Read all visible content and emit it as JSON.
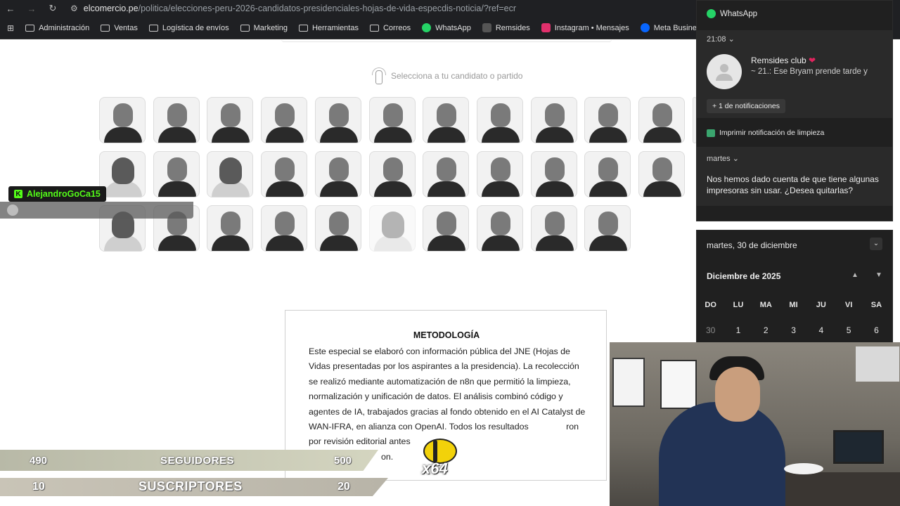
{
  "browser": {
    "nav": {
      "back": "←",
      "forward": "→",
      "reload": "↻"
    },
    "url": {
      "host": "elcomercio.pe",
      "path": "/politica/elecciones-peru-2026-candidatos-presidenciales-hojas-de-vida-especdis-noticia/?ref=ecr"
    },
    "bookmarks": [
      {
        "label": "Administración",
        "icon": "folder-icon"
      },
      {
        "label": "Ventas",
        "icon": "folder-icon"
      },
      {
        "label": "Logística de envíos",
        "icon": "folder-icon"
      },
      {
        "label": "Marketing",
        "icon": "folder-icon"
      },
      {
        "label": "Herramientas",
        "icon": "folder-icon"
      },
      {
        "label": "Correos",
        "icon": "folder-icon"
      },
      {
        "label": "WhatsApp",
        "icon": "whatsapp-icon",
        "color": "#25d366"
      },
      {
        "label": "Remsides",
        "icon": "remsides-icon",
        "color": "#555555"
      },
      {
        "label": "Instagram • Mensajes",
        "icon": "instagram-icon",
        "color": "#e1306c"
      },
      {
        "label": "Meta Business Suite",
        "icon": "meta-icon",
        "color": "#0866ff"
      }
    ]
  },
  "page": {
    "selector_hint": "Selecciona a tu candidato o partido",
    "methodology": {
      "title": "METODOLOGÍA",
      "body": "Este especial se elaboró con información pública del JNE (Hojas de Vidas presentadas por los aspirantes a la presidencia). La recolección se realizó mediante automatización de n8n que permitió la limpieza, normalización y unificación de datos. El análisis combinó código y agentes de IA, trabajados gracias al fondo obtenido en el AI Catalyst de WAN-IFRA, en alianza con OpenAI. Todos los resultados",
      "tail_1": "ron por revisión editorial antes",
      "tail_2": "on."
    }
  },
  "stream": {
    "chat_user": "AlejandroGoCa15",
    "followers": {
      "current": "490",
      "label": "SEGUIDORES",
      "goal": "500"
    },
    "subscribers": {
      "current": "10",
      "label": "SUSCRIPTORES",
      "goal": "20"
    },
    "multiplier": "x64"
  },
  "notifications": {
    "app": "WhatsApp",
    "time": "21:08",
    "chat_title": "Remsides club",
    "chat_message": "~ 21.: Ese Bryam prende tarde y",
    "more": "+ 1 de notificaciones",
    "printer_title": "Imprimir notificación de limpieza",
    "printer_day": "martes",
    "printer_message": "Nos hemos dado cuenta de que tiene algunas impresoras sin usar. ¿Desea quitarlas?"
  },
  "calendar": {
    "date": "martes, 30 de diciembre",
    "month": "Diciembre de 2025",
    "dows": [
      "DO",
      "LU",
      "MA",
      "MI",
      "JU",
      "VI",
      "SA"
    ],
    "days": [
      "30",
      "1",
      "2",
      "3",
      "4",
      "5",
      "6"
    ]
  }
}
